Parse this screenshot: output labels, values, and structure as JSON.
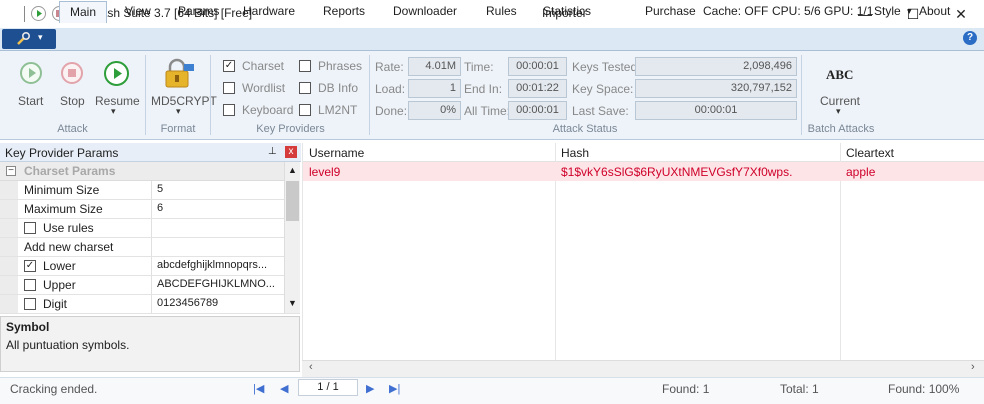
{
  "titlebar": {
    "title": "Hash Suite 3.7 [64 Bits] [Free]",
    "window_title": "Importer",
    "minimize": "—",
    "maximize": "☐",
    "close": "✕"
  },
  "menubar": {
    "tabs": [
      "Main",
      "View",
      "Params",
      "Hardware",
      "Reports",
      "Downloader",
      "Rules",
      "Statistics"
    ],
    "active_tab": "Main",
    "purchase": "Purchase",
    "cache": "Cache: OFF",
    "cpu_gpu": "CPU: 5/6 GPU: 1/1",
    "style": "Style",
    "about": "About",
    "help": "?"
  },
  "ribbon": {
    "attack": {
      "start": "Start",
      "stop": "Stop",
      "resume": "Resume",
      "label": "Attack"
    },
    "format": {
      "value": "MD5CRYPT",
      "label": "Format"
    },
    "providers": {
      "charset": "Charset",
      "wordlist": "Wordlist",
      "keyboard": "Keyboard",
      "phrases": "Phrases",
      "db_info": "DB Info",
      "lm2nt": "LM2NT",
      "charset_checked": "✓",
      "label": "Key Providers"
    },
    "status": {
      "rate_label": "Rate:",
      "rate": "4.01M",
      "load_label": "Load:",
      "load": "1",
      "done_label": "Done:",
      "done": "0%",
      "time_label": "Time:",
      "time": "00:00:01",
      "end_label": "End In:",
      "end": "00:01:22",
      "alltime_label": "All Time:",
      "alltime": "00:00:01",
      "tested_label": "Keys Tested:",
      "tested": "2,098,496",
      "space_label": "Key Space:",
      "space": "320,797,152",
      "lastsave_label": "Last Save:",
      "lastsave": "00:00:01",
      "label": "Attack Status"
    },
    "batch": {
      "icon_text": "ABC",
      "current": "Current",
      "label": "Batch Attacks"
    }
  },
  "left_panel": {
    "title": "Key Provider Params",
    "pin": "⊥",
    "close": "x",
    "section": "Charset Params",
    "section_toggle": "−",
    "rows": [
      {
        "name": "Minimum Size",
        "value": "5",
        "check": ""
      },
      {
        "name": "Maximum Size",
        "value": "6",
        "check": ""
      },
      {
        "name": "Use rules",
        "value": "",
        "check": " "
      },
      {
        "name": "Add new charset",
        "value": "",
        "check": ""
      },
      {
        "name": "Lower",
        "value": "abcdefghijklmnopqrs...",
        "check": "✓"
      },
      {
        "name": "Upper",
        "value": "ABCDEFGHIJKLMNO...",
        "check": " "
      },
      {
        "name": "Digit",
        "value": "0123456789",
        "check": " "
      }
    ],
    "desc_title": "Symbol",
    "desc_text": "All puntuation symbols."
  },
  "grid": {
    "columns": [
      "Username",
      "Hash",
      "Cleartext"
    ],
    "rows": [
      {
        "username": "level9",
        "hash": "$1$vkY6sSlG$6RyUXtNMEVGsfY7Xf0wps.",
        "cleartext": "apple"
      }
    ]
  },
  "statusbar": {
    "message": "Cracking ended.",
    "page": "1 / 1",
    "found": "Found: 1",
    "total": "Total: 1",
    "found_pct": "Found: 100%"
  },
  "colors": {
    "accent": "#dde8f5",
    "found_row": "#fce4e7",
    "found_text": "#d0002a",
    "play_green": "#2e9e3a"
  }
}
